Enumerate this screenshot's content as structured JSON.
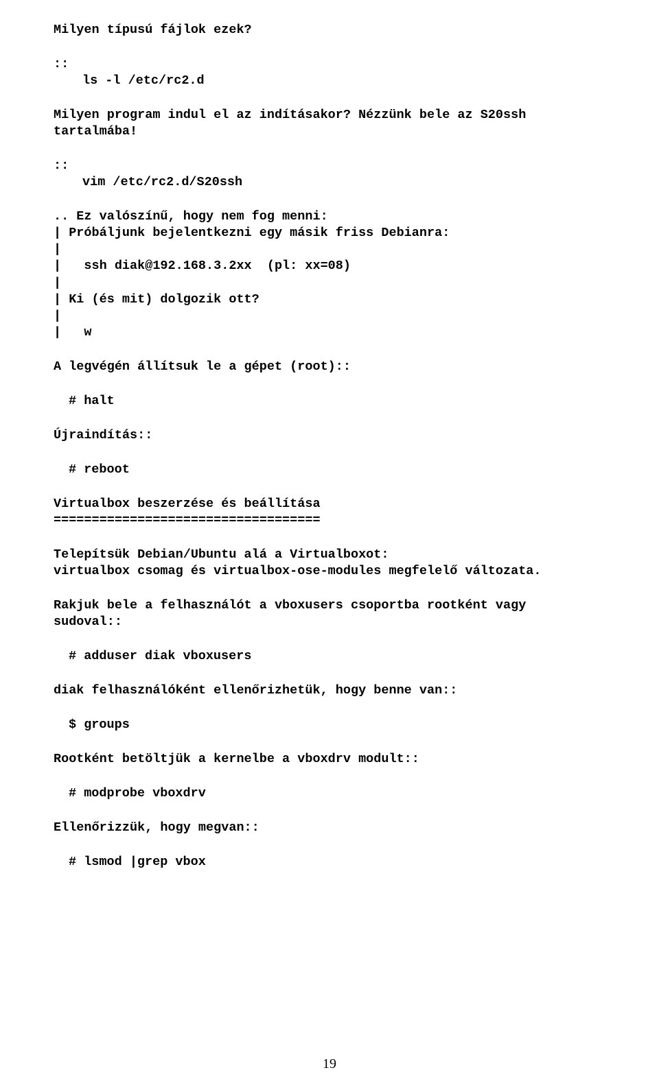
{
  "q1": "Milyen típusú fájlok ezek?",
  "p1a": "::",
  "p1b": "ls -l /etc/rc2.d",
  "q2": "Milyen program indul el az indításakor? Nézzünk bele az S20ssh tartalmába!",
  "p2a": "::",
  "p2b": "vim /etc/rc2.d/S20ssh",
  "b3a": ".. Ez valószínű, hogy nem fog menni:",
  "b3b": "| Próbáljunk bejelentkezni egy másik friss Debianra:",
  "b3c": "|",
  "b3d": "|   ssh diak@192.168.3.2xx  (pl: xx=08)",
  "b3e": "|",
  "b3f": "| Ki (és mit) dolgozik ott?",
  "b3g": "|",
  "b3h": "|   w",
  "q4": "A legvégén állítsuk le a gépet (root)::",
  "c4": "# halt",
  "q5": "Újraindítás::",
  "c5": "# reboot",
  "h6a": "Virtualbox beszerzése és beállítása",
  "h6b": "===================================",
  "t7a": "Telepítsük Debian/Ubuntu alá a Virtualboxot:",
  "t7b": "virtualbox csomag és virtualbox-ose-modules megfelelő változata.",
  "t8": "Rakjuk bele a felhasználót a vboxusers csoportba rootként vagy sudoval::",
  "c8": "# adduser diak vboxusers",
  "t9": "diak felhasználóként ellenőrizhetük, hogy benne van::",
  "c9": "$ groups",
  "t10": "Rootként betöltjük a kernelbe a vboxdrv modult::",
  "c10": "# modprobe vboxdrv",
  "t11": "Ellenőrizzük, hogy megvan::",
  "c11": "# lsmod |grep vbox",
  "page_number": "19"
}
